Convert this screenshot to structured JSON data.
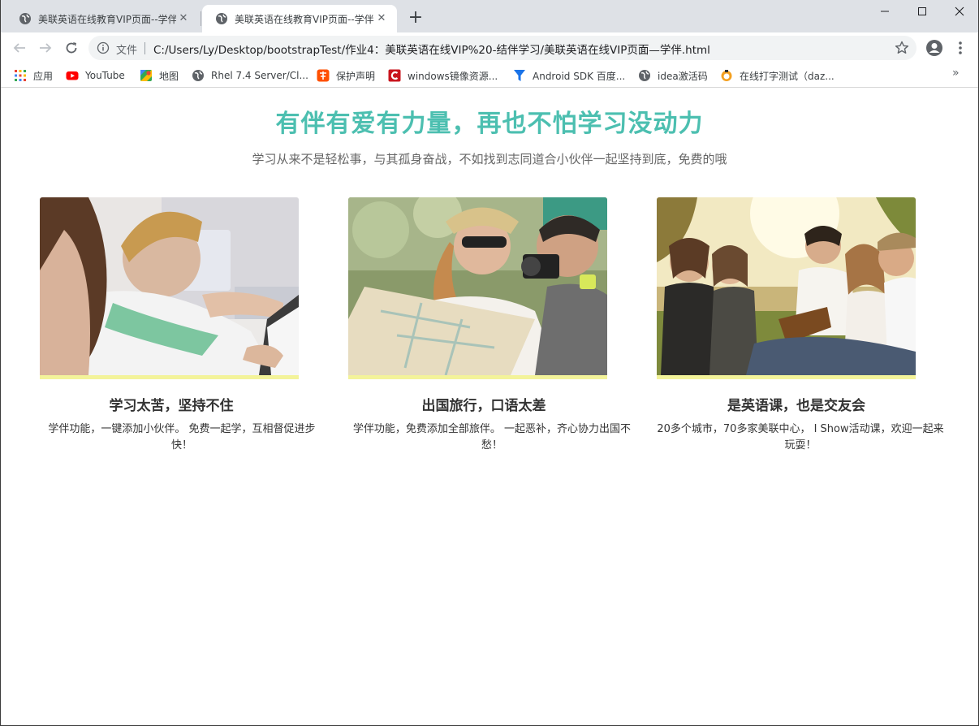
{
  "browser": {
    "tabs": [
      {
        "title": "美联英语在线教育VIP页面--学伴",
        "close": "✕"
      },
      {
        "title": "美联英语在线教育VIP页面--学伴",
        "close": "✕"
      }
    ],
    "new_tab": "+",
    "address": {
      "scheme_label": "文件",
      "url": "C:/Users/Ly/Desktop/bootstrapTest/作业4：美联英语在线VIP%20-结伴学习/美联英语在线VIP页面—学伴.html"
    },
    "bookmarks": [
      {
        "label": "应用",
        "icon": "apps-grid-icon"
      },
      {
        "label": "YouTube",
        "icon": "youtube-icon"
      },
      {
        "label": "地图",
        "icon": "maps-icon"
      },
      {
        "label": "Rhel 7.4 Server/Cl...",
        "icon": "globe-icon"
      },
      {
        "label": "保护声明",
        "icon": "taobao-icon"
      },
      {
        "label": "windows镜像资源...",
        "icon": "csdn-icon"
      },
      {
        "label": "Android SDK 百度...",
        "icon": "funnel-icon"
      },
      {
        "label": "idea激活码",
        "icon": "globe-icon"
      },
      {
        "label": "在线打字测试（daz...",
        "icon": "typing-test-icon"
      }
    ],
    "bookmarks_more": "»"
  },
  "page": {
    "title": "有伴有爱有力量，再也不怕学习没动力",
    "subtitle": "学习从来不是轻松事，与其孤身奋战，不如找到志同道合小伙伴一起坚持到底，免费的哦",
    "cards": [
      {
        "title": "学习太苦，坚持不住",
        "desc": "学伴功能，一键添加小伙伴。 免费一起学，互相督促进步快！"
      },
      {
        "title": "出国旅行，口语太差",
        "desc": "学伴功能，免费添加全部旅伴。 一起恶补，齐心协力出国不愁！"
      },
      {
        "title": "是英语课，也是交友会",
        "desc": "20多个城市，70多家美联中心，  I Show活动课，欢迎一起来玩耍！"
      }
    ]
  },
  "colors": {
    "title_teal": "#4cbfb0",
    "photo_underline": "#f3f39a",
    "tab_strip": "#dee1e6"
  }
}
